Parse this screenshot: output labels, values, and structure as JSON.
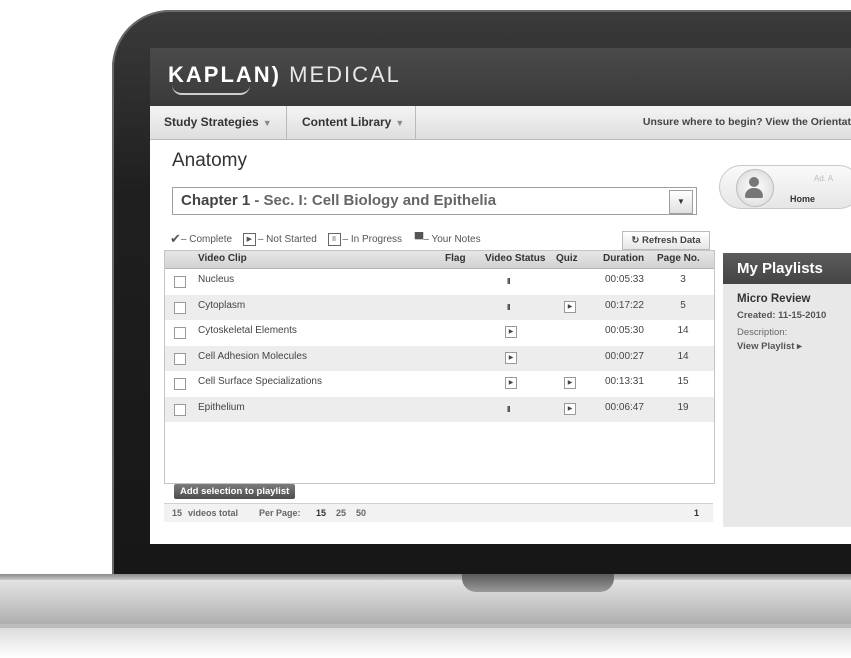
{
  "header": {
    "logo_bold": "KAPLAN",
    "logo_light": "MEDICAL"
  },
  "nav": {
    "study_strategies": "Study Strategies",
    "content_library": "Content Library",
    "helper_text": "Unsure where to begin? View the Orientat"
  },
  "page": {
    "title": "Anatomy"
  },
  "chapter_select": {
    "chapter": "Chapter 1",
    "section": " - Sec. I: Cell Biology and Epithelia"
  },
  "legend": {
    "complete": "– Complete",
    "not_started": "– Not Started",
    "in_progress": "– In Progress",
    "notes": "– Your Notes"
  },
  "refresh_button": "Refresh Data",
  "table": {
    "headers": {
      "video_clip": "Video Clip",
      "flag": "Flag",
      "video_status": "Video Status",
      "quiz": "Quiz",
      "duration": "Duration",
      "page_no": "Page No."
    },
    "rows": [
      {
        "name": "Nucleus",
        "status": "in-progress",
        "quiz": "",
        "duration": "00:05:33",
        "page": "3"
      },
      {
        "name": "Cytoplasm",
        "status": "in-progress",
        "quiz": "not-started",
        "duration": "00:17:22",
        "page": "5"
      },
      {
        "name": "Cytoskeletal Elements",
        "status": "not-started",
        "quiz": "",
        "duration": "00:05:30",
        "page": "14"
      },
      {
        "name": "Cell Adhesion Molecules",
        "status": "not-started",
        "quiz": "",
        "duration": "00:00:27",
        "page": "14"
      },
      {
        "name": "Cell Surface Specializations",
        "status": "not-started",
        "quiz": "not-started",
        "duration": "00:13:31",
        "page": "15"
      },
      {
        "name": "Epithelium",
        "status": "in-progress",
        "quiz": "not-started",
        "duration": "00:06:47",
        "page": "19"
      }
    ]
  },
  "add_button": "Add selection to playlist",
  "footer": {
    "total": "15",
    "total_label": "videos total",
    "per_page_label": "Per Page:",
    "options": [
      "15",
      "25",
      "50"
    ],
    "page": "1"
  },
  "user": {
    "home_label": "Home",
    "name_partial": "Ad. A"
  },
  "playlists": {
    "heading": "My Playlists",
    "item_title": "Micro Review",
    "created": "Created: 11-15-2010",
    "description_label": "Description:",
    "view_link": "View Playlist ▸"
  },
  "icons": {
    "complete": "checkmark-icon",
    "not_started": "play-icon",
    "in_progress": "pause-icon",
    "notes": "speech-bubble-icon",
    "refresh": "refresh-icon"
  }
}
